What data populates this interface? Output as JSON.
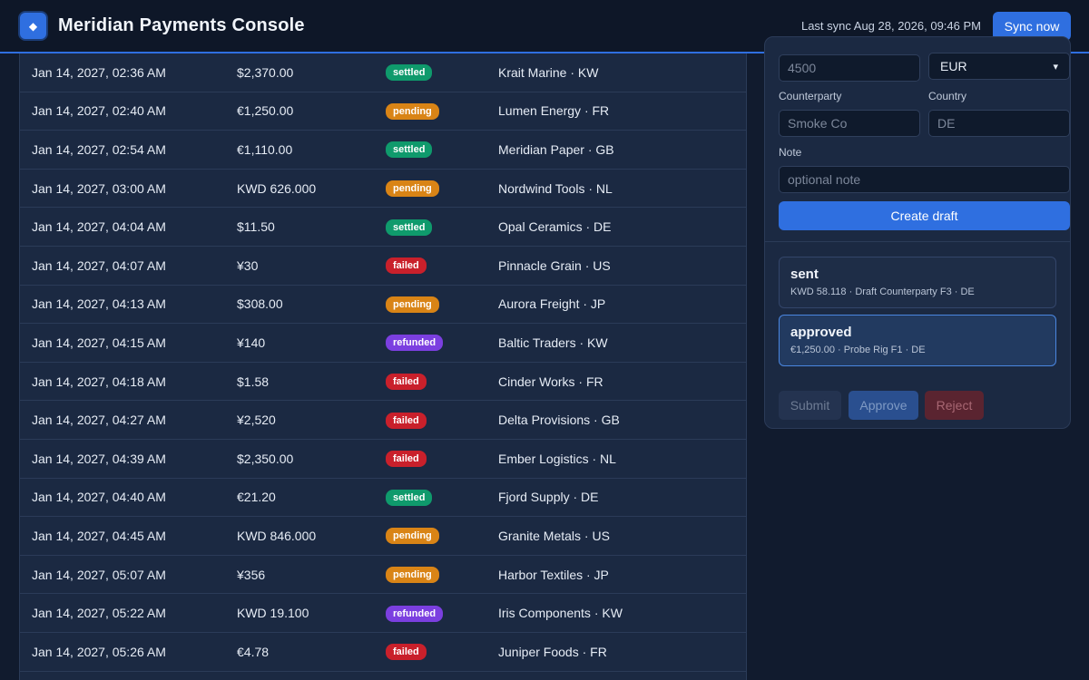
{
  "header": {
    "title": "Meridian Payments Console",
    "logo_icon": "diamond-icon",
    "last_sync": "Last sync Aug 28, 2026, 09:46 PM",
    "sync_label": "Sync now"
  },
  "colors": {
    "accent": "#2f6fe0",
    "settled": "#0f9a6c",
    "pending": "#d98416",
    "failed": "#c9202b",
    "refunded": "#7b3fe0"
  },
  "transactions": [
    {
      "date": "Jan 14, 2027, 02:36 AM",
      "amount": "$2,370.00",
      "status": "settled",
      "counterparty": "Krait Marine · KW"
    },
    {
      "date": "Jan 14, 2027, 02:40 AM",
      "amount": "€1,250.00",
      "status": "pending",
      "counterparty": "Lumen Energy · FR"
    },
    {
      "date": "Jan 14, 2027, 02:54 AM",
      "amount": "€1,110.00",
      "status": "settled",
      "counterparty": "Meridian Paper · GB"
    },
    {
      "date": "Jan 14, 2027, 03:00 AM",
      "amount": "KWD 626.000",
      "status": "pending",
      "counterparty": "Nordwind Tools · NL"
    },
    {
      "date": "Jan 14, 2027, 04:04 AM",
      "amount": "$11.50",
      "status": "settled",
      "counterparty": "Opal Ceramics · DE"
    },
    {
      "date": "Jan 14, 2027, 04:07 AM",
      "amount": "¥30",
      "status": "failed",
      "counterparty": "Pinnacle Grain · US"
    },
    {
      "date": "Jan 14, 2027, 04:13 AM",
      "amount": "$308.00",
      "status": "pending",
      "counterparty": "Aurora Freight · JP"
    },
    {
      "date": "Jan 14, 2027, 04:15 AM",
      "amount": "¥140",
      "status": "refunded",
      "counterparty": "Baltic Traders · KW"
    },
    {
      "date": "Jan 14, 2027, 04:18 AM",
      "amount": "$1.58",
      "status": "failed",
      "counterparty": "Cinder Works · FR"
    },
    {
      "date": "Jan 14, 2027, 04:27 AM",
      "amount": "¥2,520",
      "status": "failed",
      "counterparty": "Delta Provisions · GB"
    },
    {
      "date": "Jan 14, 2027, 04:39 AM",
      "amount": "$2,350.00",
      "status": "failed",
      "counterparty": "Ember Logistics · NL"
    },
    {
      "date": "Jan 14, 2027, 04:40 AM",
      "amount": "€21.20",
      "status": "settled",
      "counterparty": "Fjord Supply · DE"
    },
    {
      "date": "Jan 14, 2027, 04:45 AM",
      "amount": "KWD 846.000",
      "status": "pending",
      "counterparty": "Granite Metals · US"
    },
    {
      "date": "Jan 14, 2027, 05:07 AM",
      "amount": "¥356",
      "status": "pending",
      "counterparty": "Harbor Textiles · JP"
    },
    {
      "date": "Jan 14, 2027, 05:22 AM",
      "amount": "KWD 19.100",
      "status": "refunded",
      "counterparty": "Iris Components · KW"
    },
    {
      "date": "Jan 14, 2027, 05:26 AM",
      "amount": "€4.78",
      "status": "failed",
      "counterparty": "Juniper Foods · FR"
    },
    {
      "date": "",
      "amount": "",
      "status": "",
      "counterparty": ""
    }
  ],
  "draft_form": {
    "amount_placeholder": "4500",
    "currency_value": "EUR",
    "counterparty_label": "Counterparty",
    "counterparty_placeholder": "Smoke Co",
    "country_label": "Country",
    "country_placeholder": "DE",
    "note_label": "Note",
    "note_placeholder": "optional note",
    "create_label": "Create draft"
  },
  "drafts": [
    {
      "status": "sent",
      "detail": "KWD 58.118 · Draft Counterparty F3 · DE"
    },
    {
      "status": "approved",
      "detail": "€1,250.00 · Probe Rig F1 · DE"
    }
  ],
  "actions": {
    "submit": "Submit",
    "approve": "Approve",
    "reject": "Reject"
  }
}
